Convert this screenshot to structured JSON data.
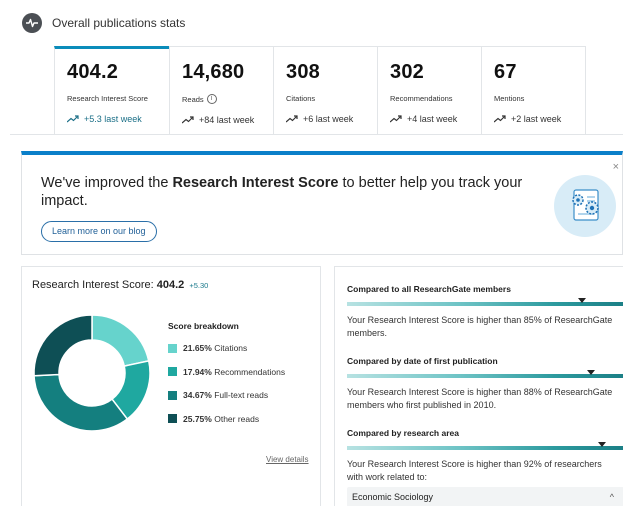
{
  "header": {
    "title": "Overall publications stats",
    "icon": "activity-pulse-icon"
  },
  "stats": [
    {
      "value": "404.2",
      "label": "Research Interest Score",
      "delta": "+5.3 last week",
      "active": true,
      "has_info": false
    },
    {
      "value": "14,680",
      "label": "Reads",
      "delta": "+84 last week",
      "active": false,
      "has_info": true
    },
    {
      "value": "308",
      "label": "Citations",
      "delta": "+6 last week",
      "active": false,
      "has_info": false
    },
    {
      "value": "302",
      "label": "Recommendations",
      "delta": "+4 last week",
      "active": false,
      "has_info": false
    },
    {
      "value": "67",
      "label": "Mentions",
      "delta": "+2 last week",
      "active": false,
      "has_info": false
    }
  ],
  "banner": {
    "text_prefix": "We've improved the ",
    "text_bold": "Research Interest Score",
    "text_suffix": " to better help you track your impact.",
    "link_label": "Learn more on our blog",
    "close_glyph": "×",
    "illustration_icon": "gears-document-icon"
  },
  "score_panel": {
    "label": "Research Interest Score:",
    "value": "404.2",
    "delta": "+5.30",
    "breakdown_title": "Score breakdown",
    "view_details": "View details"
  },
  "chart_data": {
    "type": "pie",
    "style": "donut",
    "title": "Score breakdown",
    "series": [
      {
        "name": "Citations",
        "pct_label": "21.65%",
        "value": 21.65,
        "color": "#66d3cc"
      },
      {
        "name": "Recommendations",
        "pct_label": "17.94%",
        "value": 17.94,
        "color": "#1fa8a0"
      },
      {
        "name": "Full-text reads",
        "pct_label": "34.67%",
        "value": 34.67,
        "color": "#147f7f"
      },
      {
        "name": "Other reads",
        "pct_label": "25.75%",
        "value": 25.75,
        "color": "#0e4f55"
      }
    ]
  },
  "comparisons": [
    {
      "title": "Compared to all ResearchGate members",
      "marker_pct": 85,
      "text": "Your Research Interest Score is higher than 85% of ResearchGate members."
    },
    {
      "title": "Compared by date of first publication",
      "marker_pct": 88,
      "text": "Your Research Interest Score is higher than 88% of ResearchGate members who first published in 2010."
    },
    {
      "title": "Compared by research area",
      "marker_pct": 92,
      "text": "Your Research Interest Score is higher than 92% of researchers with work related to:"
    }
  ],
  "research_area_select": {
    "value": "Economic Sociology",
    "chevron": "^"
  }
}
